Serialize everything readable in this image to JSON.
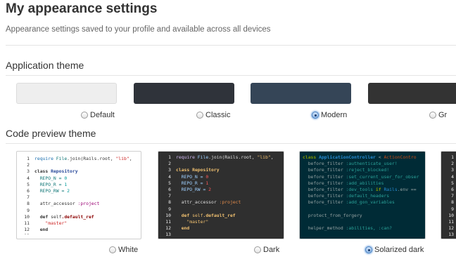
{
  "page": {
    "title": "My appearance settings",
    "subtitle": "Appearance settings saved to your profile and available across all devices"
  },
  "application_theme": {
    "heading": "Application theme",
    "selected": "Modern",
    "options": [
      {
        "label": "Default",
        "color": "#eeeeee",
        "checked": false
      },
      {
        "label": "Classic",
        "color": "#2f333a",
        "checked": false
      },
      {
        "label": "Modern",
        "color": "#354557",
        "checked": true
      },
      {
        "label": "Gr",
        "color": "#333333",
        "checked": false
      }
    ]
  },
  "code_preview_theme": {
    "heading": "Code preview theme",
    "selected": "Solarized dark",
    "options": [
      {
        "label": "White",
        "checked": false
      },
      {
        "label": "Dark",
        "checked": false
      },
      {
        "label": "Solarized dark",
        "checked": true
      },
      {
        "label": "",
        "checked": false
      }
    ]
  },
  "code_samples": {
    "ruby": {
      "line_numbers": [
        "1",
        "2",
        "3",
        "4",
        "5",
        "6",
        "7",
        "8",
        "9",
        "10",
        "11",
        "12",
        "13"
      ],
      "lines": [
        [
          {
            "t": "require ",
            "k": "kw2"
          },
          {
            "t": "File",
            "k": "const"
          },
          {
            "t": ".join(Rails.root, ",
            "k": "plain"
          },
          {
            "t": "\"lib\"",
            "k": "str"
          },
          {
            "t": ",",
            "k": "plain"
          }
        ],
        [],
        [
          {
            "t": "class ",
            "k": "kw"
          },
          {
            "t": "Repository",
            "k": "cls"
          }
        ],
        [
          {
            "t": "  REPO_N = ",
            "k": "const"
          },
          {
            "t": "0",
            "k": "num"
          }
        ],
        [
          {
            "t": "  REPO_R = ",
            "k": "const"
          },
          {
            "t": "1",
            "k": "num"
          }
        ],
        [
          {
            "t": "  REPO_RW = ",
            "k": "const"
          },
          {
            "t": "2",
            "k": "num"
          }
        ],
        [],
        [
          {
            "t": "  attr_accessor ",
            "k": "plain"
          },
          {
            "t": ":project",
            "k": "sym"
          }
        ],
        [],
        [
          {
            "t": "  def ",
            "k": "kw"
          },
          {
            "t": "self",
            "k": "kwself"
          },
          {
            "t": ".default_ref",
            "k": "meth"
          }
        ],
        [
          {
            "t": "    \"master\"",
            "k": "str"
          }
        ],
        [
          {
            "t": "  end",
            "k": "kw"
          }
        ],
        []
      ]
    },
    "controller": {
      "line_numbers": [],
      "lines": [
        [
          {
            "t": "class ",
            "k": "kw"
          },
          {
            "t": "ApplicationController",
            "k": "cls"
          },
          {
            "t": " < ",
            "k": "plain"
          },
          {
            "t": "ActionContro",
            "k": "cls2"
          }
        ],
        [
          {
            "t": "  before_filter ",
            "k": "plain"
          },
          {
            "t": ":authenticate_user!",
            "k": "sym"
          }
        ],
        [
          {
            "t": "  before_filter ",
            "k": "plain"
          },
          {
            "t": ":reject_blocked!",
            "k": "sym"
          }
        ],
        [
          {
            "t": "  before_filter ",
            "k": "plain"
          },
          {
            "t": ":set_current_user_for_obser",
            "k": "sym"
          }
        ],
        [
          {
            "t": "  before_filter ",
            "k": "plain"
          },
          {
            "t": ":add_abilities",
            "k": "sym"
          }
        ],
        [
          {
            "t": "  before_filter ",
            "k": "plain"
          },
          {
            "t": ":dev_tools ",
            "k": "sym"
          },
          {
            "t": "if ",
            "k": "kw"
          },
          {
            "t": "Rails",
            "k": "const"
          },
          {
            "t": ".env ==",
            "k": "plain"
          }
        ],
        [
          {
            "t": "  before_filter ",
            "k": "plain"
          },
          {
            "t": ":default_headers",
            "k": "sym"
          }
        ],
        [
          {
            "t": "  before_filter ",
            "k": "plain"
          },
          {
            "t": ":add_gon_variables",
            "k": "sym"
          }
        ],
        [],
        [
          {
            "t": "  protect_from_forgery",
            "k": "plain"
          }
        ],
        [],
        [
          {
            "t": "  helper_method ",
            "k": "plain"
          },
          {
            "t": ":abilities, :can?",
            "k": "sym"
          }
        ]
      ]
    }
  },
  "colors": {
    "white_theme": {
      "bg": "#ffffff",
      "gutter": "#333333",
      "plain": "#333333",
      "kw": "#333333",
      "kw2": "#1a6fb0",
      "kwself": "#333333",
      "const": "#117777",
      "cls": "#2a4a9a",
      "cls2": "#2a4a9a",
      "num": "#009999",
      "str": "#cc2222",
      "sym": "#990073",
      "meth": "#8b0000"
    },
    "dark_theme": {
      "bg": "#2f2f2f",
      "gutter": "#eeeeee",
      "plain": "#dddddd",
      "kw": "#f0c070",
      "kw2": "#d0b8f0",
      "kwself": "#f0c070",
      "const": "#9fd0ff",
      "cls": "#f0c070",
      "cls2": "#f0c070",
      "num": "#ff5a5a",
      "str": "#f0c070",
      "sym": "#e08a4a",
      "meth": "#f0c070"
    },
    "solarized_theme": {
      "bg": "#002b36",
      "gutter": "#586e75",
      "plain": "#93a1a1",
      "kw": "#859900",
      "kw2": "#859900",
      "kwself": "#859900",
      "const": "#268bd2",
      "cls": "#268bd2",
      "cls2": "#cb4b16",
      "num": "#2aa198",
      "str": "#2aa198",
      "sym": "#2aa198",
      "meth": "#268bd2"
    }
  }
}
